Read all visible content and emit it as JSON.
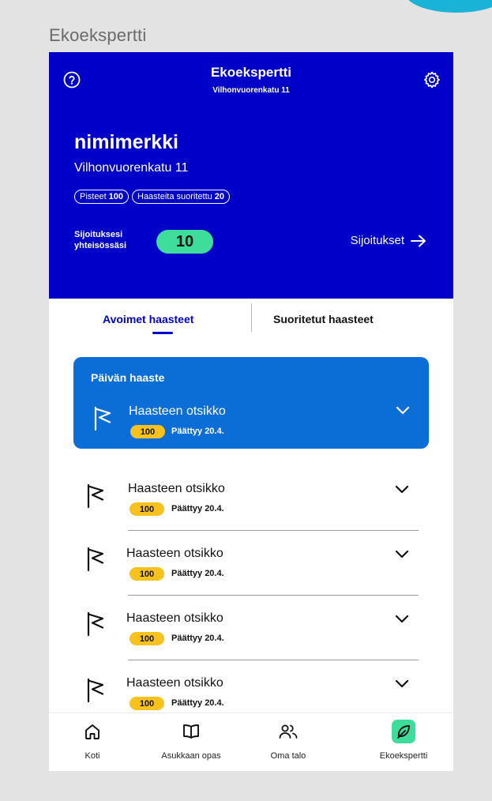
{
  "frame_label": "Ekoekspertti",
  "header": {
    "title": "Ekoekspertti",
    "subtitle": "Vilhonvuorenkatu 11",
    "nickname": "nimimerkki",
    "address": "Vilhonvuorenkatu 11",
    "points_label": "Pisteet",
    "points_value": "100",
    "completed_label": "Haasteita suoritettu",
    "completed_value": "20",
    "rank_label_line1": "Sijoituksesi",
    "rank_label_line2": "yhteisössäsi",
    "rank_value": "10",
    "rankings_link": "Sijoitukset"
  },
  "tabs": {
    "open": "Avoimet haasteet",
    "completed": "Suoritetut haasteet",
    "active": "open"
  },
  "daily": {
    "heading": "Päivän haaste",
    "title": "Haasteen otsikko",
    "points": "100",
    "ends": "Päättyy 20.4."
  },
  "challenges": [
    {
      "title": "Haasteen otsikko",
      "points": "100",
      "ends": "Päättyy 20.4."
    },
    {
      "title": "Haasteen otsikko",
      "points": "100",
      "ends": "Päättyy 20.4."
    },
    {
      "title": "Haasteen otsikko",
      "points": "100",
      "ends": "Päättyy 20.4."
    },
    {
      "title": "Haasteen otsikko",
      "points": "100",
      "ends": "Päättyy 20.4."
    }
  ],
  "nav": [
    {
      "label": "Koti",
      "icon": "home-icon"
    },
    {
      "label": "Asukkaan opas",
      "icon": "book-icon"
    },
    {
      "label": "Oma talo",
      "icon": "users-icon"
    },
    {
      "label": "Ekoekspertti",
      "icon": "leaf-icon",
      "active": true
    }
  ],
  "colors": {
    "header_bg": "#0000c8",
    "daily_bg": "#0a6ed6",
    "accent_green": "#3fdd9b",
    "points_yellow": "#f7c21e"
  }
}
